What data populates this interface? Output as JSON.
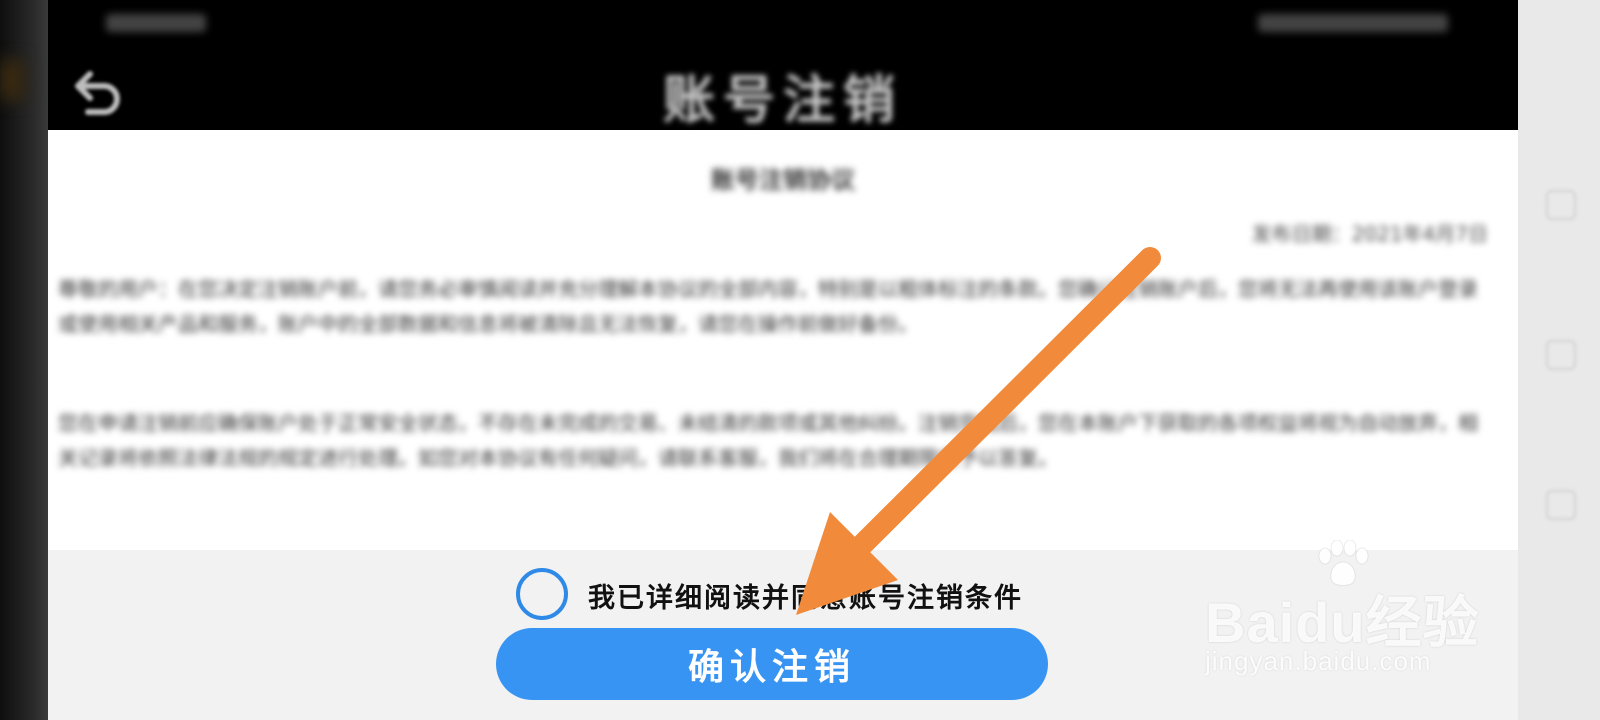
{
  "header": {
    "title": "账号注销",
    "back_icon": "back-arrow-icon"
  },
  "document": {
    "title": "账号注销协议",
    "date": "发布日期：2021年4月7日",
    "paragraphs": [
      "尊敬的用户：在您决定注销账户前，请您务必审慎阅读并充分理解本协议的全部内容，特别是以粗体标注的条款。您确认注销账户后，您将无法再使用该账户登录或使用相关产品和服务，账户中的全部数据和信息将被清除且无法恢复，请您在操作前做好备份。",
      "您在申请注销前应确保账户处于正常安全状态，不存在未完成的交易、未结清的款项或其他纠纷。注销完成后，您在本账户下获取的各项权益将视为自动放弃，相关记录将依照法律法规的规定进行处理。如您对本协议有任何疑问，请联系客服，我们将在合理期限内予以答复。"
    ]
  },
  "agreement": {
    "label": "我已详细阅读并同意账号注销条件",
    "checked": false
  },
  "confirm_button": {
    "label": "确认注销"
  },
  "annotation": {
    "arrow_color": "#f18a3a"
  },
  "watermark": {
    "brand": "Baidu经验",
    "site": "jingyan.baidu.com"
  },
  "colors": {
    "accent": "#3894f2",
    "checkbox_border": "#2f89e6"
  }
}
